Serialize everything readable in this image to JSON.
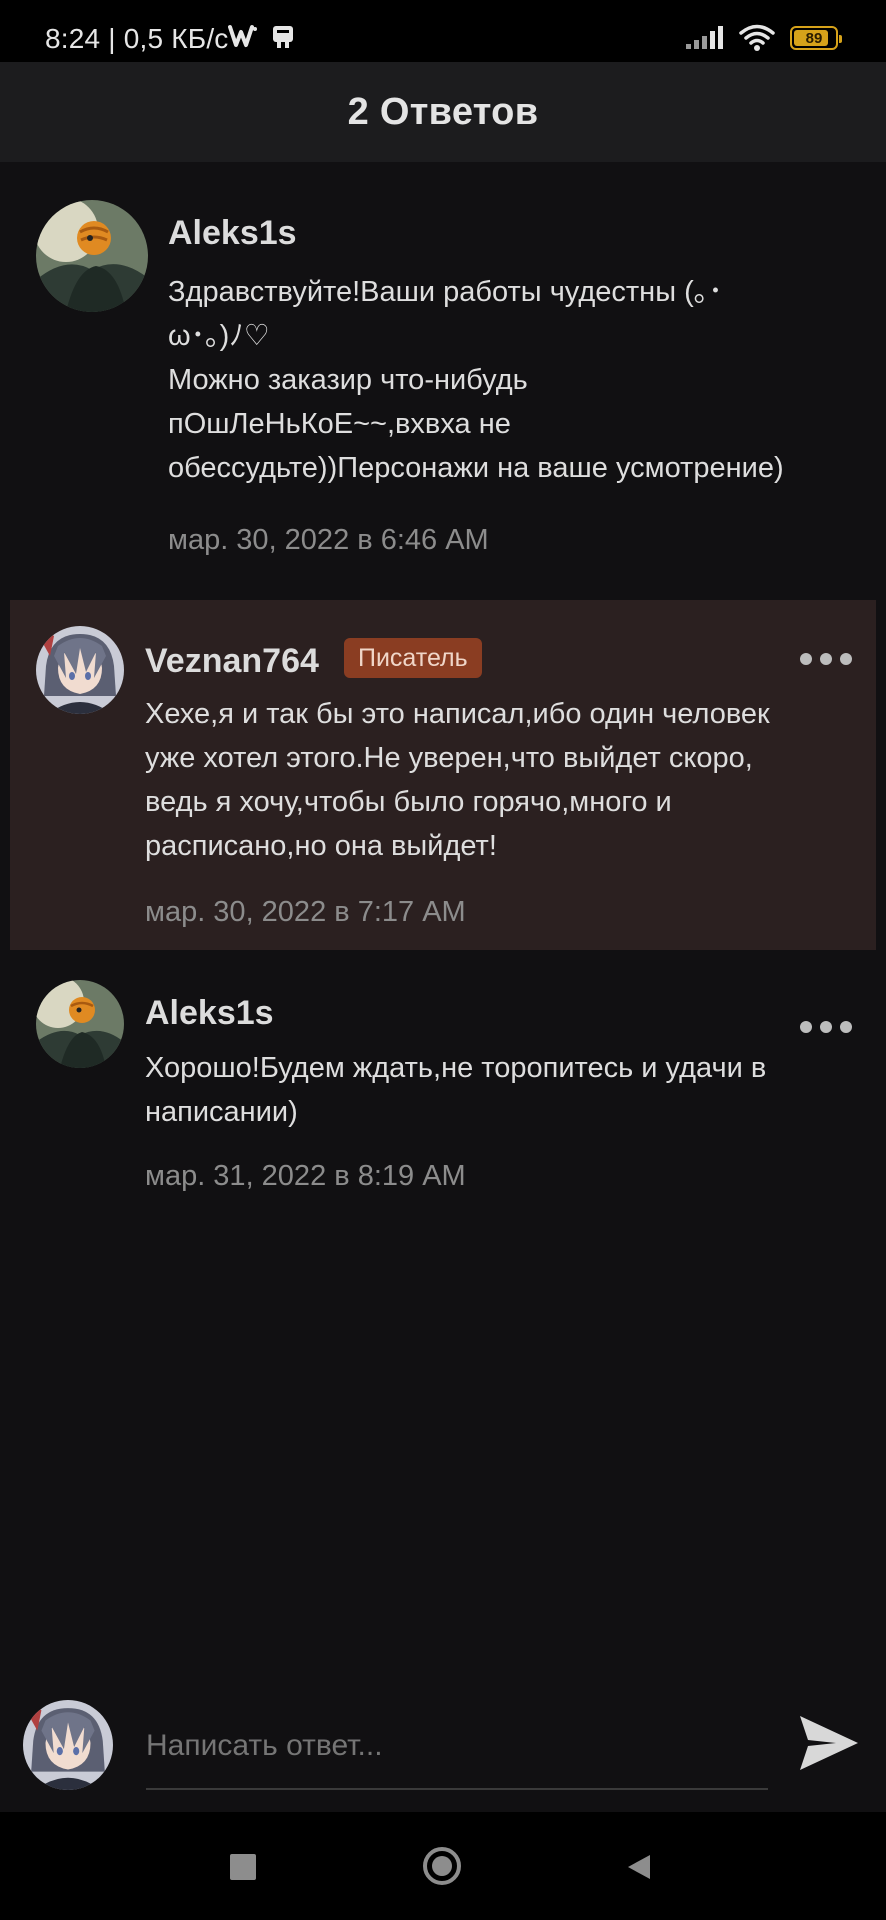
{
  "status_bar": {
    "text": "8:24 | 0,5 КБ/с",
    "battery_level": "89",
    "icons": [
      "w-app-icon",
      "store-icon",
      "signal-icon",
      "wifi-icon",
      "battery-icon"
    ]
  },
  "header": {
    "title": "2 Ответов"
  },
  "comments": [
    {
      "author": "Aleks1s",
      "badge": "",
      "lines": [
        "Здравствуйте!Ваши работы чудестны (｡･",
        "ω･｡)ﾉ♡",
        "Можно заказир что-нибудь",
        "пОшЛеНьКоЕ~~,вхвха не",
        "обессудьте))Персонажи на ваше усмотрение)"
      ],
      "timestamp": "мар. 30, 2022 в 6:46 AM"
    },
    {
      "author": "Veznan764",
      "badge": "Писатель",
      "lines": [
        "Хехе,я и так бы это написал,ибо один человек",
        "уже хотел этого.Не уверен,что выйдет скоро,",
        "ведь я хочу,чтобы было горячо,много и",
        "расписано,но она выйдет!"
      ],
      "timestamp": "мар. 30, 2022 в 7:17 AM"
    },
    {
      "author": "Aleks1s",
      "badge": "",
      "lines": [
        "Хорошо!Будем ждать,не торопитесь и удачи в",
        "написании)"
      ],
      "timestamp": "мар. 31, 2022 в 8:19 AM"
    }
  ],
  "reply": {
    "placeholder": "Написать ответ..."
  },
  "colors": {
    "background": "#111012",
    "header": "#1c1c1e",
    "highlight": "#2b2020",
    "badge": "#8a3d22",
    "battery": "#d6a21a"
  }
}
